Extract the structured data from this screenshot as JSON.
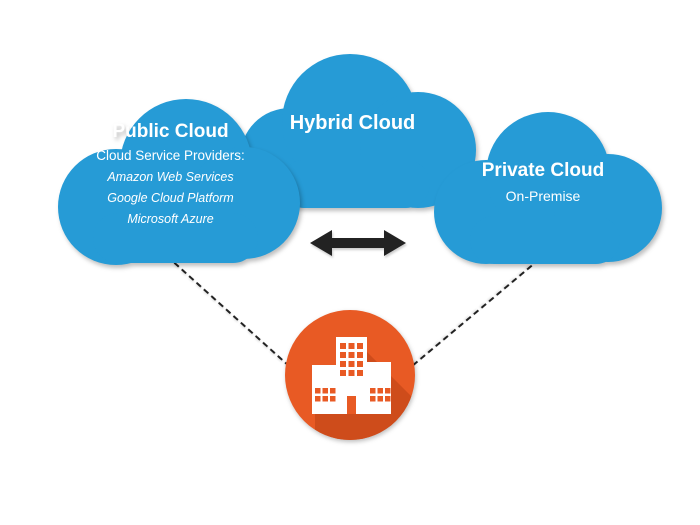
{
  "clouds": {
    "hybrid": {
      "title": "Hybrid Cloud"
    },
    "public": {
      "title": "Public Cloud",
      "subtitle": "Cloud Service Providers:",
      "providers": [
        "Amazon Web Services",
        "Google Cloud Platform",
        "Microsoft Azure"
      ]
    },
    "private": {
      "title": "Private Cloud",
      "subtitle": "On-Premise"
    }
  },
  "colors": {
    "cloud": "#269bd6",
    "accent": "#e85a24",
    "arrow": "#222222"
  }
}
